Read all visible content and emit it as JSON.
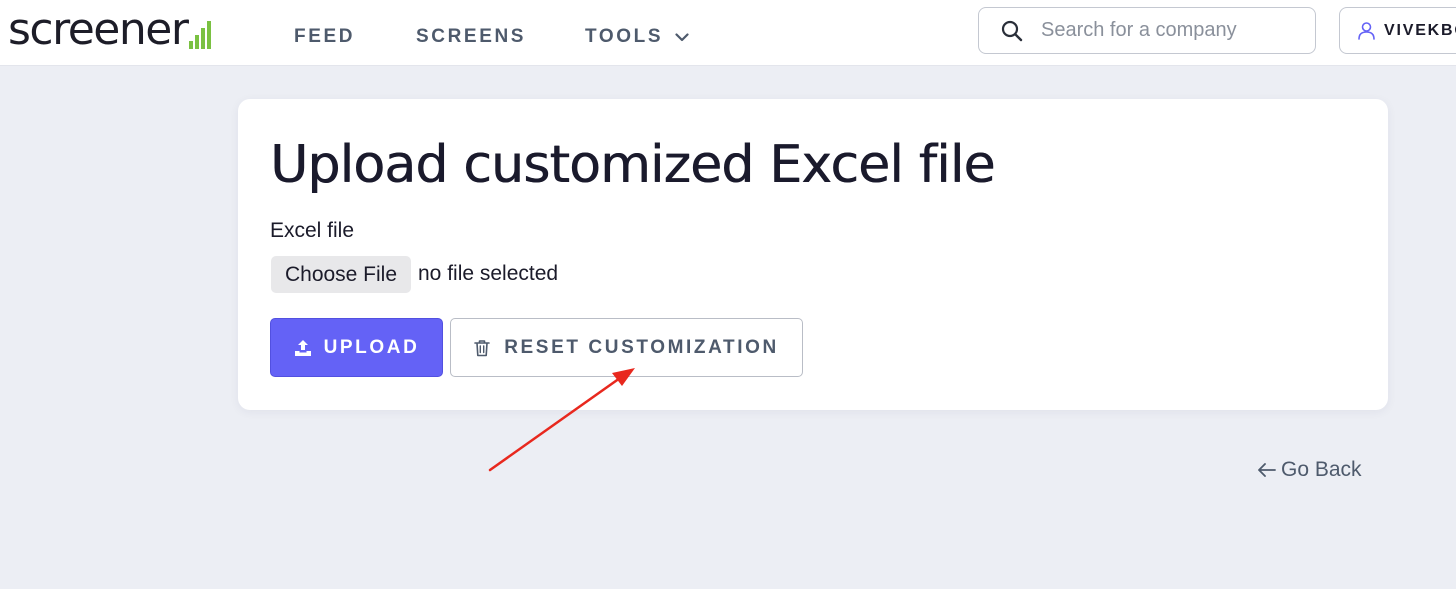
{
  "nav": {
    "logo_text": "screener",
    "links": [
      {
        "label": "FEED"
      },
      {
        "label": "SCREENS"
      },
      {
        "label": "TOOLS"
      }
    ],
    "search": {
      "placeholder": "Search for a company",
      "value": ""
    },
    "user": {
      "label": "VIVEKBO"
    }
  },
  "card": {
    "title": "Upload customized Excel file",
    "field_label": "Excel file",
    "choose_file_label": "Choose File",
    "file_status": "no file selected",
    "upload_label": "UPLOAD",
    "reset_label": "RESET CUSTOMIZATION"
  },
  "go_back": {
    "label": "Go Back"
  },
  "icons": {
    "logo": "signal-bars-icon",
    "tools": "chevron-down-icon",
    "search": "search-icon",
    "user": "user-icon",
    "upload": "upload-icon",
    "reset": "trash-icon",
    "go_back": "arrow-left-icon"
  },
  "colors": {
    "accent": "#6462f6",
    "logo_bars": "#7ac142",
    "annotation": "#e8281e",
    "background": "#eceef4"
  }
}
